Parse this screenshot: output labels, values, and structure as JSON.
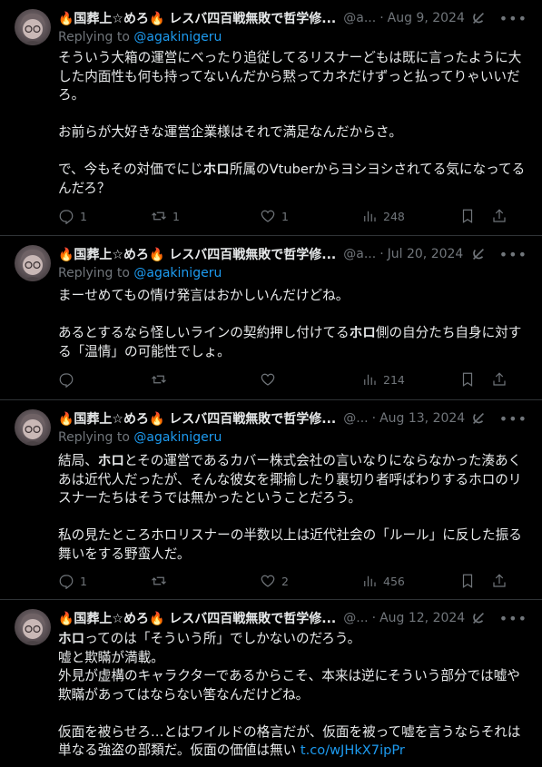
{
  "tweets": [
    {
      "name": "🔥国葬上☆めろ🔥 レスバ四百戦無敗で哲学修...",
      "handle": "@a...",
      "date": "Aug 9, 2024",
      "reply_prefix": "Replying to ",
      "reply_to": "@agakinigeru",
      "body_html": "そういう大箱の運営にべったり追従してるリスナーどもは既に言ったように大した内面性も何も持ってないんだから黙ってカネだけずっと払ってりゃいいだろ。\n\nお前らが大好きな運営企業様はそれで満足なんだからさ。\n\nで、今もその対価でにじ<b>ホロ</b>所属のVtuberからヨシヨシされてる気になってるんだろ？",
      "replies": "1",
      "retweets": "1",
      "likes": "1",
      "views": "248"
    },
    {
      "name": "🔥国葬上☆めろ🔥 レスバ四百戦無敗で哲学修...",
      "handle": "@a...",
      "date": "Jul 20, 2024",
      "reply_prefix": "Replying to ",
      "reply_to": "@agakinigeru",
      "body_html": "まーせめてもの情け発言はおかしいんだけどね。\n\nあるとするなら怪しいラインの契約押し付けてる<b>ホロ</b>側の自分たち自身に対する「温情」の可能性でしょ。",
      "replies": "",
      "retweets": "",
      "likes": "",
      "views": "214"
    },
    {
      "name": "🔥国葬上☆めろ🔥 レスバ四百戦無敗で哲学修...",
      "handle": "@...",
      "date": "Aug 13, 2024",
      "reply_prefix": "Replying to ",
      "reply_to": "@agakinigeru",
      "body_html": "結局、<b>ホロ</b>とその運営であるカバー株式会社の言いなりにならなかった湊あくあは近代人だったが、そんな彼女を揶揄したり裏切り者呼ばわりするホロのリスナーたちはそうでは無かったということだろう。\n\n私の見たところホロリスナーの半数以上は近代社会の「ルール」に反した振る舞いをする野蛮人だ。",
      "replies": "1",
      "retweets": "",
      "likes": "2",
      "views": "456"
    },
    {
      "name": "🔥国葬上☆めろ🔥 レスバ四百戦無敗で哲学修...",
      "handle": "@...",
      "date": "Aug 12, 2024",
      "body_html": "<b>ホロ</b>ってのは「そういう所」でしかないのだろう。\n嘘と欺瞞が満載。\n外見が虚構のキャラクターであるからこそ、本来は逆にそういう部分では嘘や欺瞞があってはならない筈なんだけどね。\n\n仮面を被らせろ…とはワイルドの格言だが、仮面を被って嘘を言うならそれは単なる強盗の部類だ。仮面の価値は無い <span class=\"link\">t.co/wJHkX7ipPr</span>"
    }
  ]
}
